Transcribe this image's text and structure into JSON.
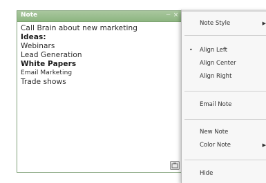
{
  "note": {
    "title": "Note",
    "minimize_glyph": "−",
    "close_glyph": "×",
    "lines": [
      "Call Brain about new marketing",
      "Ideas:",
      "Webinars",
      "Lead Generation",
      "White Papers",
      "Email Marketing",
      "Trade shows"
    ],
    "resize_icon": "resize-grip-icon"
  },
  "menu": {
    "items": [
      {
        "label": "Note Style",
        "submenu": true,
        "checked": false
      },
      {
        "label": "Align Left",
        "submenu": false,
        "checked": true
      },
      {
        "label": "Align Center",
        "submenu": false,
        "checked": false
      },
      {
        "label": "Align Right",
        "submenu": false,
        "checked": false
      },
      {
        "label": "Email Note",
        "submenu": false,
        "checked": false
      },
      {
        "label": "New Note",
        "submenu": false,
        "checked": false
      },
      {
        "label": "Color Note",
        "submenu": true,
        "checked": false
      },
      {
        "label": "Hide",
        "submenu": false,
        "checked": false
      }
    ],
    "submenu_glyph": "▶",
    "check_glyph": "•"
  },
  "colors": {
    "note_titlebar": "#8db581",
    "note_border": "#7f9f76",
    "menu_background": "#f7f7f7",
    "menu_separator": "#cfcfcf"
  }
}
